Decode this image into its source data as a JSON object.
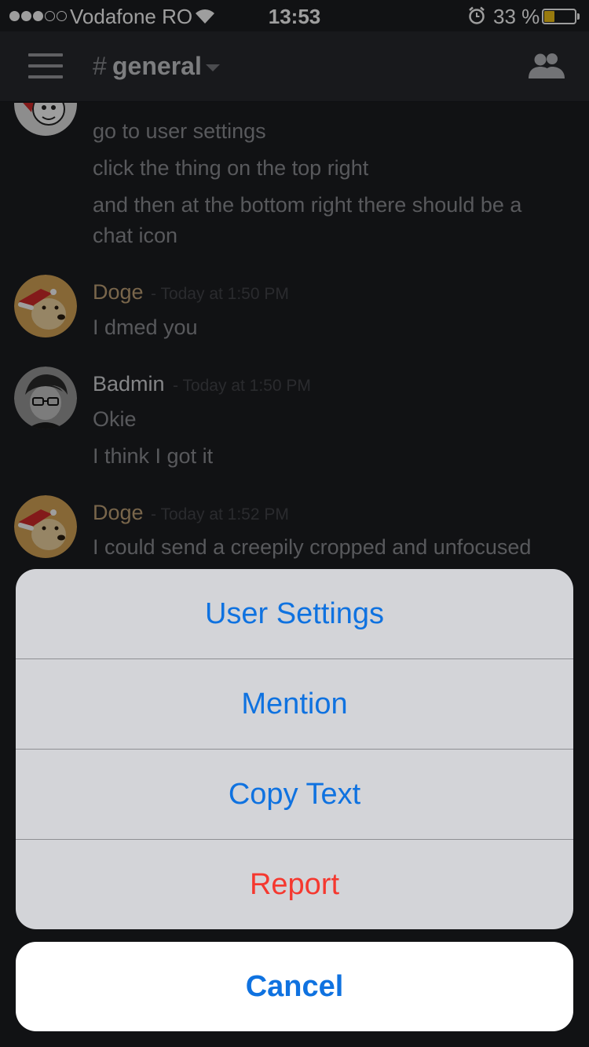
{
  "status_bar": {
    "carrier": "Vodafone RO",
    "time": "13:53",
    "battery_percent": "33 %",
    "battery_level": 0.33,
    "signal_bars_filled": 3,
    "signal_bars_total": 5
  },
  "header": {
    "hash": "#",
    "channel": "general",
    "menu_icon": "hamburger-menu-icon",
    "members_icon": "members-icon"
  },
  "messages": [
    {
      "author": "",
      "timestamp": "",
      "author_color": "#3ba55d",
      "lines": [
        "go to user settings",
        "click the thing on the top right",
        "and then at the bottom right there should be a",
        "chat icon"
      ]
    },
    {
      "author": "Doge",
      "timestamp": "- Today at 1:50 PM",
      "author_color": "#c4a57a",
      "lines": [
        "I dmed you"
      ]
    },
    {
      "author": "Badmin",
      "timestamp": "- Today at 1:50 PM",
      "author_color": "#d6d7da",
      "lines": [
        "Okie",
        "I think I got it"
      ]
    },
    {
      "author": "Doge",
      "timestamp": "- Today at 1:52 PM",
      "author_color": "#c4a57a",
      "lines": [
        "I could send a creepily cropped and unfocused"
      ]
    }
  ],
  "action_sheet": {
    "items": [
      "User Settings",
      "Mention",
      "Copy Text",
      "Report"
    ],
    "cancel": "Cancel",
    "accent_color": "#0f72e0",
    "destructive_color": "#f5382f"
  }
}
